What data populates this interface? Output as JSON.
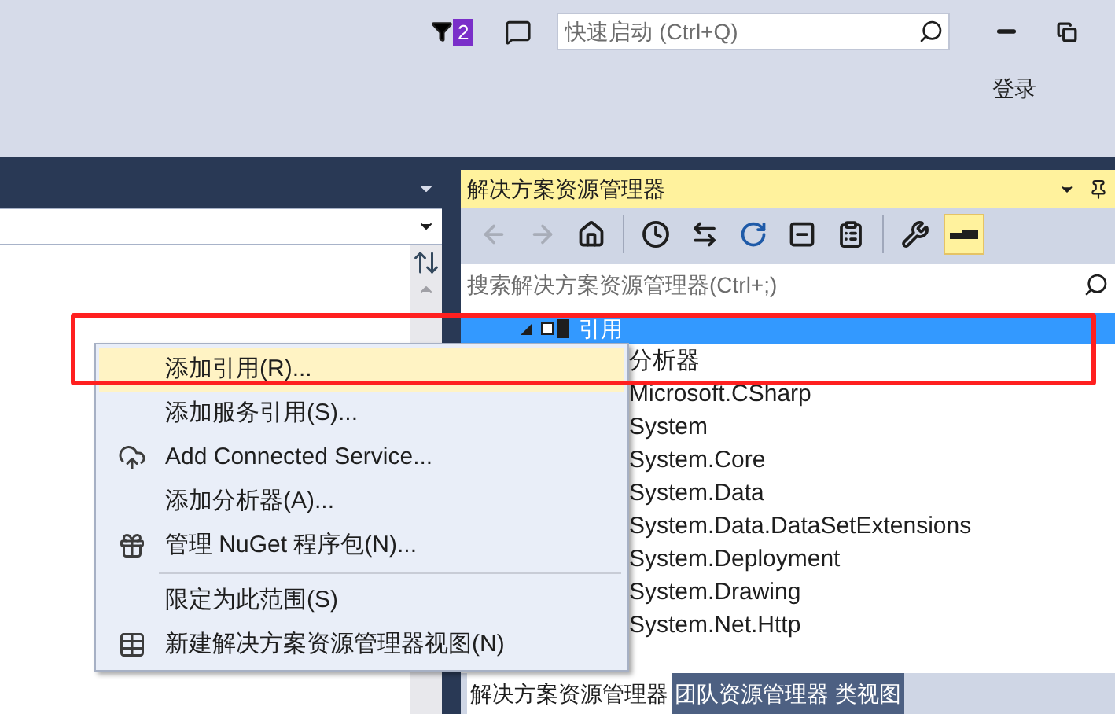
{
  "title_bar": {
    "notification_count": "2",
    "quick_launch": {
      "placeholder": "快速启动 (Ctrl+Q)"
    },
    "sign_in": "登录"
  },
  "solution_explorer": {
    "title": "解决方案资源管理器",
    "toolbar": [
      {
        "kind": "back",
        "disabled": true,
        "selected": false
      },
      {
        "kind": "forward",
        "disabled": true,
        "selected": false
      },
      {
        "kind": "home",
        "disabled": false,
        "selected": false
      },
      {
        "kind": "separator"
      },
      {
        "kind": "pending",
        "disabled": false,
        "selected": false
      },
      {
        "kind": "sync",
        "disabled": false,
        "selected": false
      },
      {
        "kind": "refresh",
        "disabled": false,
        "selected": false
      },
      {
        "kind": "collapse",
        "disabled": false,
        "selected": false
      },
      {
        "kind": "show-files",
        "disabled": false,
        "selected": false
      },
      {
        "kind": "separator"
      },
      {
        "kind": "properties",
        "disabled": false,
        "selected": false
      },
      {
        "kind": "preview",
        "disabled": false,
        "selected": true
      }
    ],
    "search": {
      "placeholder": "搜索解决方案资源管理器(Ctrl+;)"
    },
    "tree": [
      {
        "label": "引用",
        "expanded": true,
        "selected": true,
        "children": [
          {
            "label": "分析器",
            "selected": false
          },
          {
            "label": "Microsoft.CSharp",
            "selected": false
          },
          {
            "label": "System",
            "selected": false
          },
          {
            "label": "System.Core",
            "selected": false
          },
          {
            "label": "System.Data",
            "selected": false
          },
          {
            "label": "System.Data.DataSetExtensions",
            "selected": false
          },
          {
            "label": "System.Deployment",
            "selected": false
          },
          {
            "label": "System.Drawing",
            "selected": false
          },
          {
            "label": "System.Net.Http",
            "selected": false
          }
        ]
      }
    ],
    "tabs": [
      {
        "label": "解决方案资源管理器",
        "selected": true
      },
      {
        "label": "团队资源管理器",
        "selected": false
      },
      {
        "label": "类视图",
        "selected": false
      }
    ]
  },
  "context_menu": {
    "items": [
      {
        "kind": "plain",
        "label": "添加引用(R)...",
        "selected": true
      },
      {
        "kind": "plain",
        "label": "添加服务引用(S)...",
        "selected": false
      },
      {
        "kind": "connected-service",
        "label": "Add Connected Service...",
        "selected": false
      },
      {
        "kind": "plain",
        "label": "添加分析器(A)...",
        "selected": false
      },
      {
        "kind": "package",
        "label": "管理 NuGet 程序包(N)...",
        "selected": false
      },
      {
        "kind": "separator"
      },
      {
        "kind": "plain",
        "label": "限定为此范围(S)",
        "selected": false
      },
      {
        "kind": "new-view",
        "label": "新建解决方案资源管理器视图(N)",
        "selected": false
      }
    ]
  }
}
